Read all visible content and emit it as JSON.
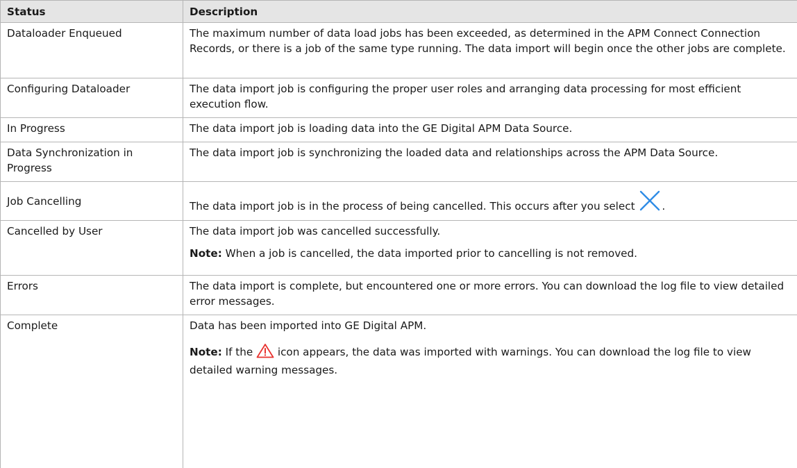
{
  "table": {
    "headers": {
      "status": "Status",
      "description": "Description"
    },
    "rows": [
      {
        "status": "Dataloader Enqueued",
        "description": "The maximum number of data load jobs has been exceeded, as determined in the APM Connect Connection Records, or there is a job of the same type running. The data import will begin once the other jobs are complete."
      },
      {
        "status": "Configuring Dataloader",
        "description": "The data import job is configuring the proper user roles and arranging data processing for most efficient execution flow."
      },
      {
        "status": "In Progress",
        "description": "The data import job is loading data into the GE Digital APM Data Source."
      },
      {
        "status": "Data Synchronization in Progress",
        "description": "The data import job is synchronizing the loaded data and relationships across the APM Data Source."
      },
      {
        "status": "Job Cancelling",
        "description_before_icon": "The data import job is in the process of being cancelled. This occurs after you select",
        "description_after_icon": ".",
        "icon": "close-x-icon"
      },
      {
        "status": "Cancelled by User",
        "description": "The data import job was cancelled successfully.",
        "note_label": "Note:",
        "note_text": " When a job is cancelled, the data imported prior to cancelling is not removed."
      },
      {
        "status": "Errors",
        "description": "The data import is complete, but encountered one or more errors. You can download the log file to view detailed error messages."
      },
      {
        "status": "Complete",
        "description": "Data has been imported into GE Digital APM.",
        "note_label": "Note:",
        "note_text_before_icon": " If the",
        "note_text_after_icon": " icon appears, the data was imported with warnings. You can download the log file to view detailed warning messages.",
        "icon": "warning-triangle-icon"
      }
    ]
  },
  "colors": {
    "header_bg": "#e5e5e5",
    "border": "#b5b5b5",
    "close_icon": "#2f8ce6",
    "warning_icon": "#e8322e"
  }
}
